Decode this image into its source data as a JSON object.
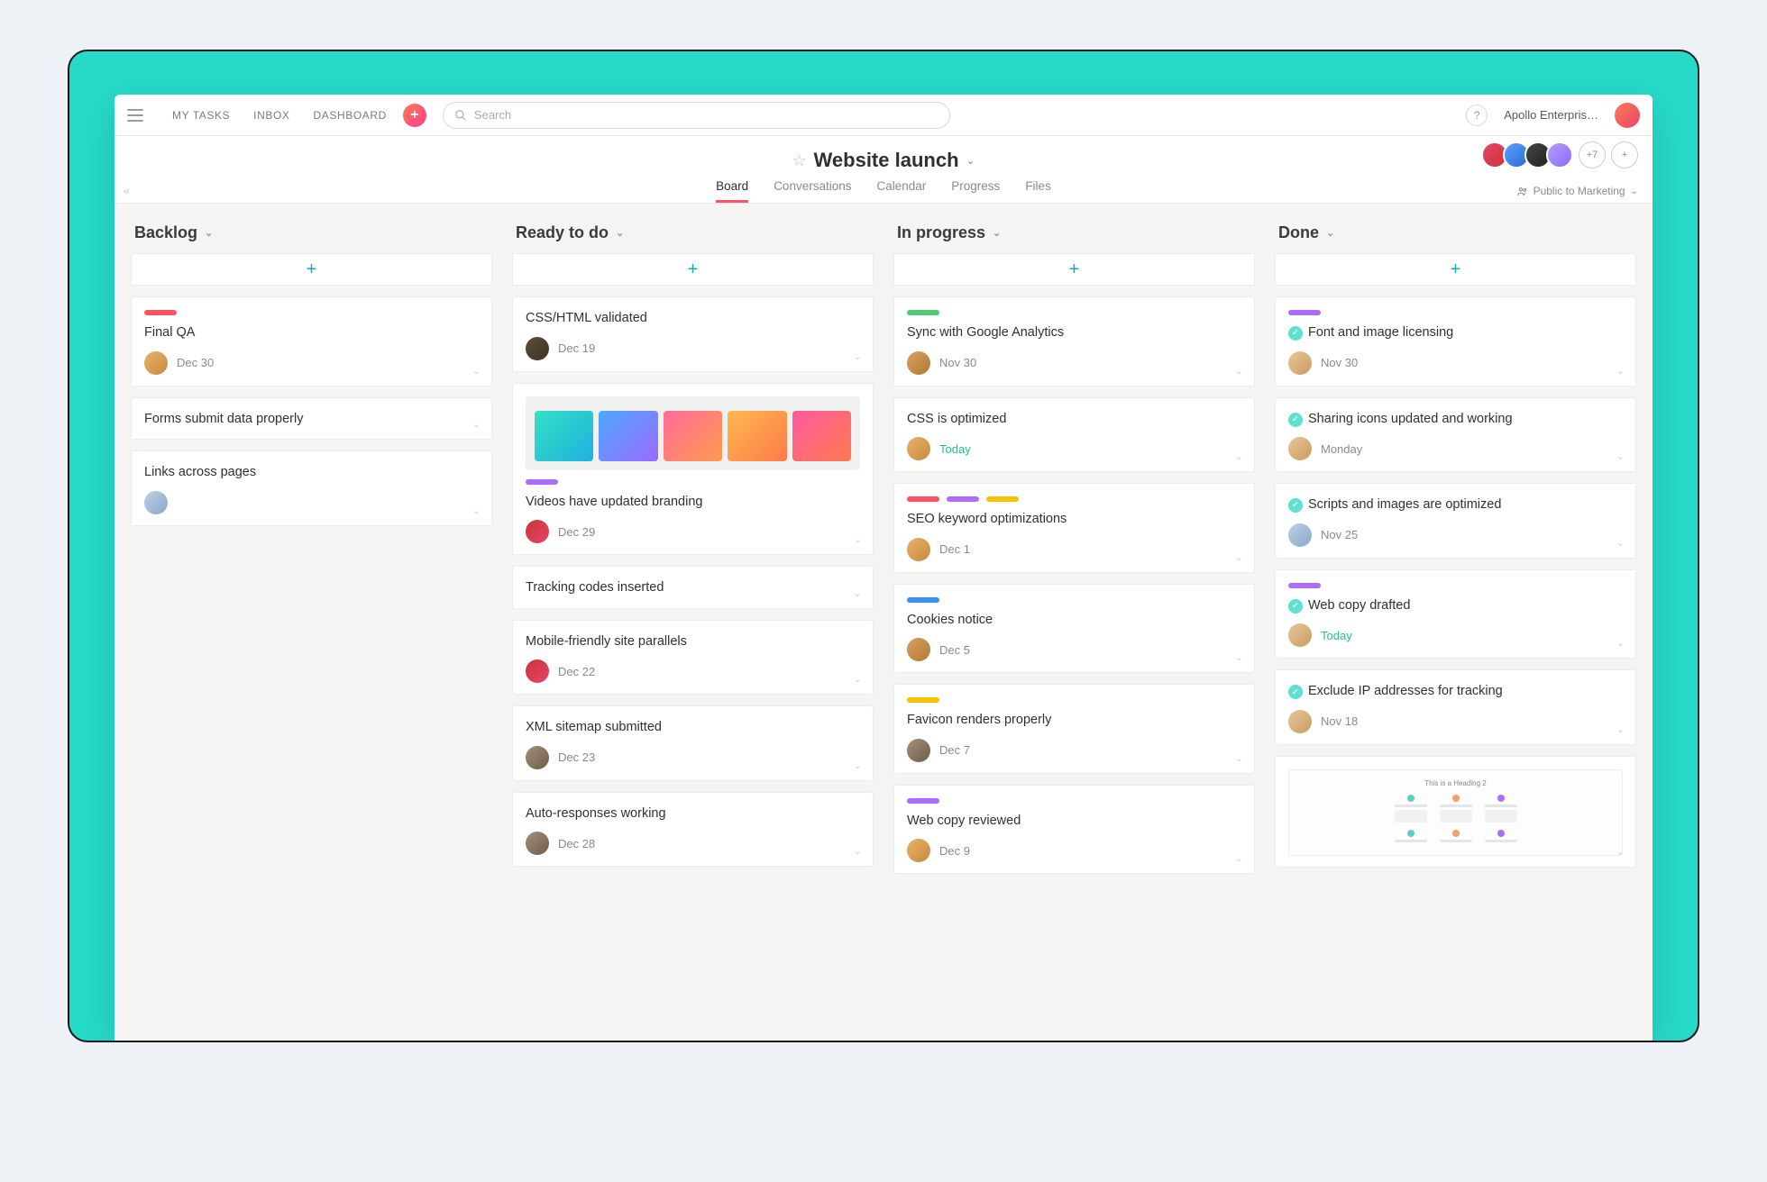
{
  "topbar": {
    "nav": {
      "my_tasks": "MY TASKS",
      "inbox": "INBOX",
      "dashboard": "DASHBOARD"
    },
    "search_placeholder": "Search",
    "help_label": "?",
    "org_name": "Apollo Enterpris…"
  },
  "project": {
    "title": "Website launch",
    "tabs": {
      "board": "Board",
      "conversations": "Conversations",
      "calendar": "Calendar",
      "progress": "Progress",
      "files": "Files"
    },
    "members_overflow": "+7",
    "add_member": "+",
    "visibility": "Public to Marketing"
  },
  "board": {
    "add_label": "+",
    "columns": [
      {
        "name": "Backlog",
        "cards": [
          {
            "tags": [
              "red"
            ],
            "title": "Final QA",
            "due": "Dec 30",
            "avatar": "a1"
          },
          {
            "title": "Forms submit data properly"
          },
          {
            "title": "Links across pages",
            "avatar": "a2"
          }
        ]
      },
      {
        "name": "Ready to do",
        "cards": [
          {
            "title": "CSS/HTML validated",
            "due": "Dec 19",
            "avatar": "a3"
          },
          {
            "thumb": "gradients",
            "tags": [
              "purple"
            ],
            "title": "Videos have updated branding",
            "due": "Dec 29",
            "avatar": "a4"
          },
          {
            "title": "Tracking codes inserted"
          },
          {
            "title": "Mobile-friendly site parallels",
            "due": "Dec 22",
            "avatar": "a4"
          },
          {
            "title": "XML sitemap submitted",
            "due": "Dec 23",
            "avatar": "a6"
          },
          {
            "title": "Auto-responses working",
            "due": "Dec 28",
            "avatar": "a6"
          }
        ]
      },
      {
        "name": "In progress",
        "cards": [
          {
            "tags": [
              "green"
            ],
            "title": "Sync with Google Analytics",
            "due": "Nov 30",
            "avatar": "a5"
          },
          {
            "title": "CSS is optimized",
            "due": "Today",
            "due_class": "today",
            "avatar": "a1"
          },
          {
            "tags": [
              "red",
              "purple",
              "yellow"
            ],
            "title": "SEO keyword optimizations",
            "due": "Dec 1",
            "avatar": "a1"
          },
          {
            "tags": [
              "blue"
            ],
            "title": "Cookies notice",
            "due": "Dec 5",
            "avatar": "a5"
          },
          {
            "tags": [
              "yellow"
            ],
            "title": "Favicon renders properly",
            "due": "Dec 7",
            "avatar": "a6"
          },
          {
            "tags": [
              "purple"
            ],
            "title": "Web copy reviewed",
            "due": "Dec 9",
            "avatar": "a1"
          }
        ]
      },
      {
        "name": "Done",
        "cards": [
          {
            "tags": [
              "purple"
            ],
            "done": true,
            "title": "Font and image licensing",
            "due": "Nov 30",
            "avatar": "a7"
          },
          {
            "done": true,
            "title": "Sharing icons updated and working",
            "due": "Monday",
            "avatar": "a7"
          },
          {
            "done": true,
            "title": "Scripts and images are optimized",
            "due": "Nov 25",
            "avatar": "a2"
          },
          {
            "tags": [
              "purple"
            ],
            "done": true,
            "title": "Web copy drafted",
            "due": "Today",
            "due_class": "today",
            "avatar": "a7"
          },
          {
            "done": true,
            "title": "Exclude IP addresses for tracking",
            "due": "Nov 18",
            "avatar": "a7"
          },
          {
            "thumb": "heading",
            "thumb_label": "This is a Heading 2"
          }
        ]
      }
    ]
  }
}
